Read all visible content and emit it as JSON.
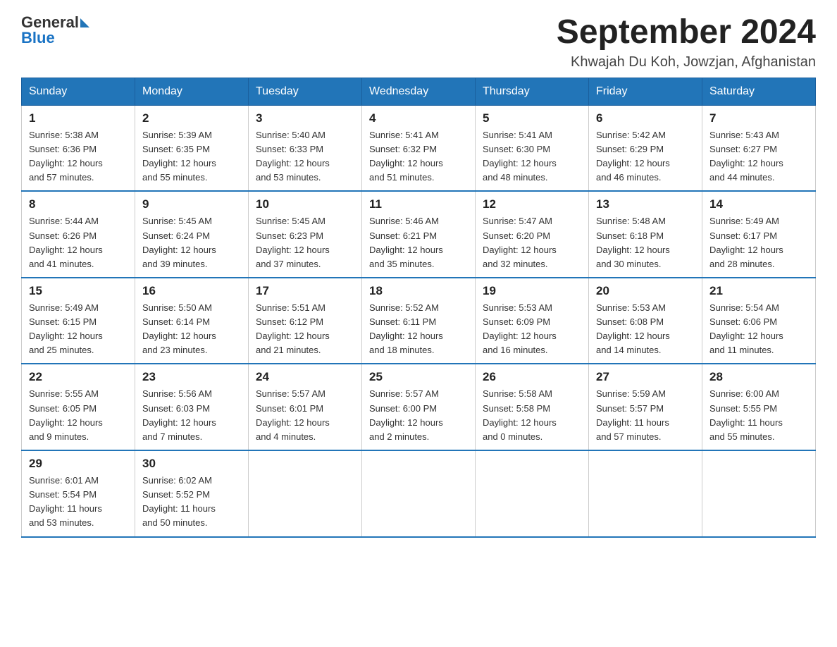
{
  "header": {
    "logo_general": "General",
    "logo_blue": "Blue",
    "title": "September 2024",
    "subtitle": "Khwajah Du Koh, Jowzjan, Afghanistan"
  },
  "days_of_week": [
    "Sunday",
    "Monday",
    "Tuesday",
    "Wednesday",
    "Thursday",
    "Friday",
    "Saturday"
  ],
  "weeks": [
    [
      {
        "day": "1",
        "sunrise": "5:38 AM",
        "sunset": "6:36 PM",
        "daylight": "12 hours and 57 minutes."
      },
      {
        "day": "2",
        "sunrise": "5:39 AM",
        "sunset": "6:35 PM",
        "daylight": "12 hours and 55 minutes."
      },
      {
        "day": "3",
        "sunrise": "5:40 AM",
        "sunset": "6:33 PM",
        "daylight": "12 hours and 53 minutes."
      },
      {
        "day": "4",
        "sunrise": "5:41 AM",
        "sunset": "6:32 PM",
        "daylight": "12 hours and 51 minutes."
      },
      {
        "day": "5",
        "sunrise": "5:41 AM",
        "sunset": "6:30 PM",
        "daylight": "12 hours and 48 minutes."
      },
      {
        "day": "6",
        "sunrise": "5:42 AM",
        "sunset": "6:29 PM",
        "daylight": "12 hours and 46 minutes."
      },
      {
        "day": "7",
        "sunrise": "5:43 AM",
        "sunset": "6:27 PM",
        "daylight": "12 hours and 44 minutes."
      }
    ],
    [
      {
        "day": "8",
        "sunrise": "5:44 AM",
        "sunset": "6:26 PM",
        "daylight": "12 hours and 41 minutes."
      },
      {
        "day": "9",
        "sunrise": "5:45 AM",
        "sunset": "6:24 PM",
        "daylight": "12 hours and 39 minutes."
      },
      {
        "day": "10",
        "sunrise": "5:45 AM",
        "sunset": "6:23 PM",
        "daylight": "12 hours and 37 minutes."
      },
      {
        "day": "11",
        "sunrise": "5:46 AM",
        "sunset": "6:21 PM",
        "daylight": "12 hours and 35 minutes."
      },
      {
        "day": "12",
        "sunrise": "5:47 AM",
        "sunset": "6:20 PM",
        "daylight": "12 hours and 32 minutes."
      },
      {
        "day": "13",
        "sunrise": "5:48 AM",
        "sunset": "6:18 PM",
        "daylight": "12 hours and 30 minutes."
      },
      {
        "day": "14",
        "sunrise": "5:49 AM",
        "sunset": "6:17 PM",
        "daylight": "12 hours and 28 minutes."
      }
    ],
    [
      {
        "day": "15",
        "sunrise": "5:49 AM",
        "sunset": "6:15 PM",
        "daylight": "12 hours and 25 minutes."
      },
      {
        "day": "16",
        "sunrise": "5:50 AM",
        "sunset": "6:14 PM",
        "daylight": "12 hours and 23 minutes."
      },
      {
        "day": "17",
        "sunrise": "5:51 AM",
        "sunset": "6:12 PM",
        "daylight": "12 hours and 21 minutes."
      },
      {
        "day": "18",
        "sunrise": "5:52 AM",
        "sunset": "6:11 PM",
        "daylight": "12 hours and 18 minutes."
      },
      {
        "day": "19",
        "sunrise": "5:53 AM",
        "sunset": "6:09 PM",
        "daylight": "12 hours and 16 minutes."
      },
      {
        "day": "20",
        "sunrise": "5:53 AM",
        "sunset": "6:08 PM",
        "daylight": "12 hours and 14 minutes."
      },
      {
        "day": "21",
        "sunrise": "5:54 AM",
        "sunset": "6:06 PM",
        "daylight": "12 hours and 11 minutes."
      }
    ],
    [
      {
        "day": "22",
        "sunrise": "5:55 AM",
        "sunset": "6:05 PM",
        "daylight": "12 hours and 9 minutes."
      },
      {
        "day": "23",
        "sunrise": "5:56 AM",
        "sunset": "6:03 PM",
        "daylight": "12 hours and 7 minutes."
      },
      {
        "day": "24",
        "sunrise": "5:57 AM",
        "sunset": "6:01 PM",
        "daylight": "12 hours and 4 minutes."
      },
      {
        "day": "25",
        "sunrise": "5:57 AM",
        "sunset": "6:00 PM",
        "daylight": "12 hours and 2 minutes."
      },
      {
        "day": "26",
        "sunrise": "5:58 AM",
        "sunset": "5:58 PM",
        "daylight": "12 hours and 0 minutes."
      },
      {
        "day": "27",
        "sunrise": "5:59 AM",
        "sunset": "5:57 PM",
        "daylight": "11 hours and 57 minutes."
      },
      {
        "day": "28",
        "sunrise": "6:00 AM",
        "sunset": "5:55 PM",
        "daylight": "11 hours and 55 minutes."
      }
    ],
    [
      {
        "day": "29",
        "sunrise": "6:01 AM",
        "sunset": "5:54 PM",
        "daylight": "11 hours and 53 minutes."
      },
      {
        "day": "30",
        "sunrise": "6:02 AM",
        "sunset": "5:52 PM",
        "daylight": "11 hours and 50 minutes."
      },
      null,
      null,
      null,
      null,
      null
    ]
  ],
  "labels": {
    "sunrise": "Sunrise:",
    "sunset": "Sunset:",
    "daylight": "Daylight:"
  }
}
